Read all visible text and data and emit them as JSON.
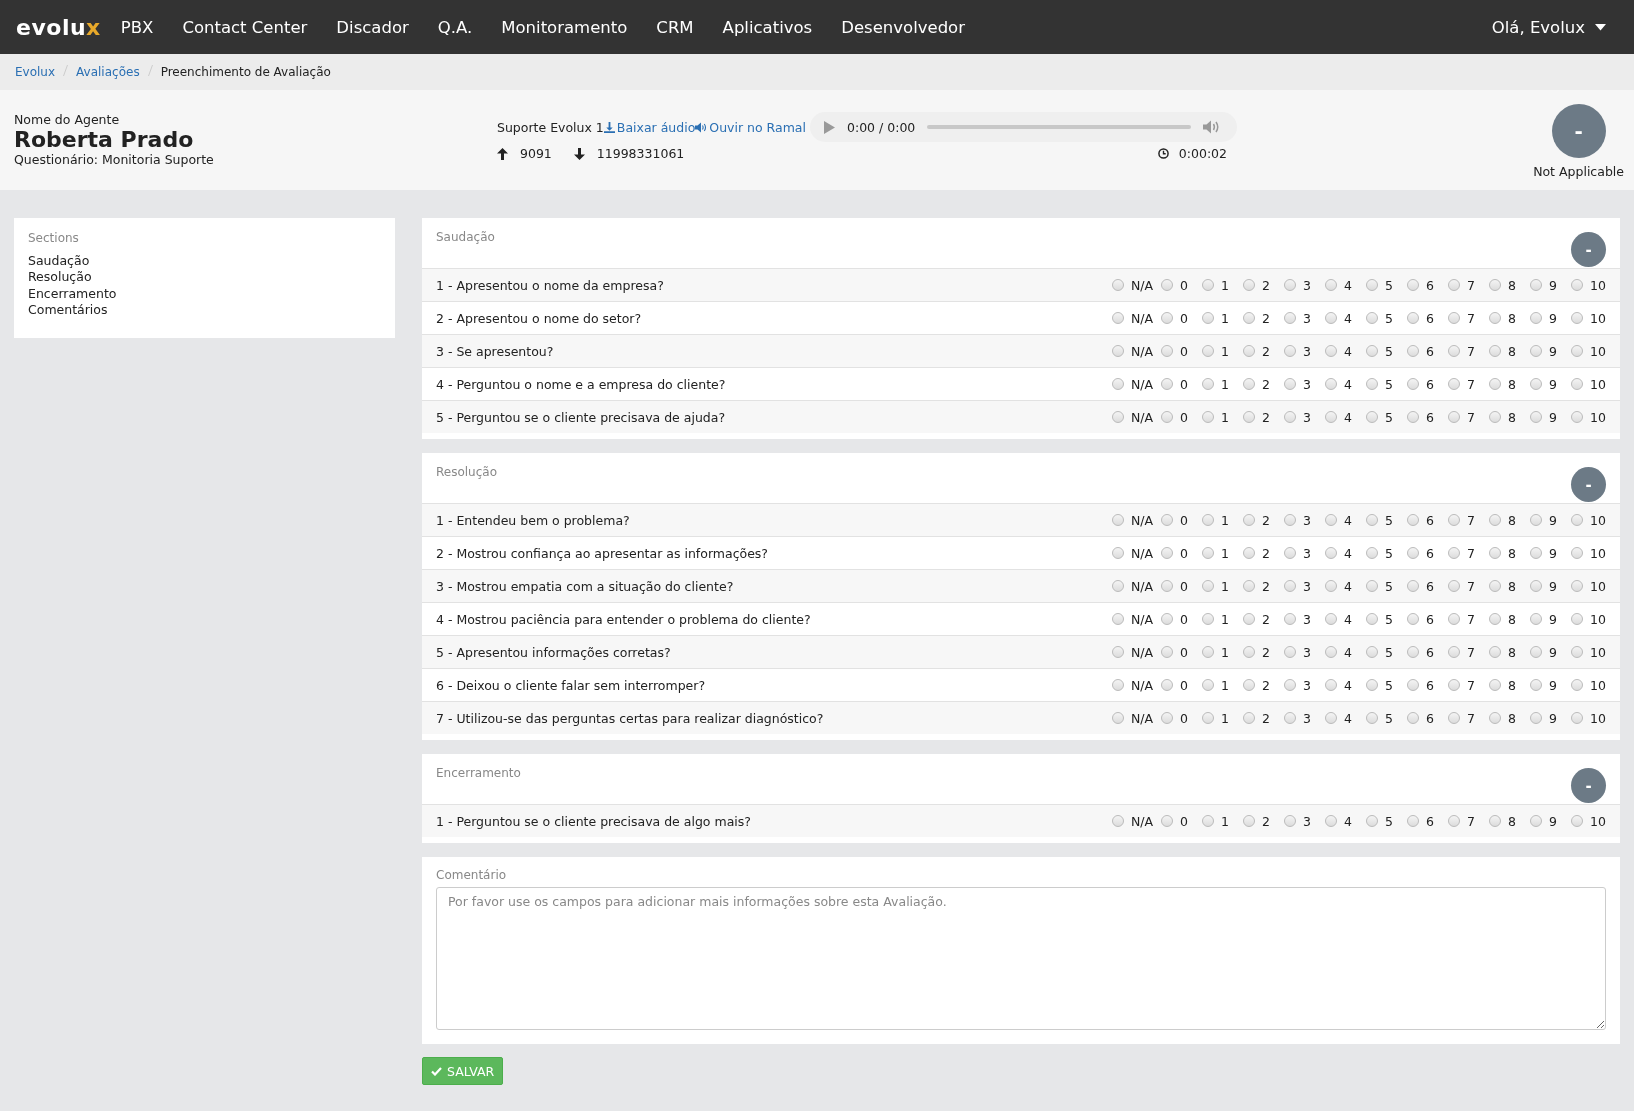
{
  "nav": {
    "logo": {
      "main": "evolu",
      "accent": "x"
    },
    "items": [
      "PBX",
      "Contact Center",
      "Discador",
      "Q.A.",
      "Monitoramento",
      "CRM",
      "Aplicativos",
      "Desenvolvedor"
    ],
    "user": "Olá, Evolux"
  },
  "breadcrumb": [
    {
      "label": "Evolux",
      "link": true
    },
    {
      "label": "Avaliações",
      "link": true
    },
    {
      "label": "Preenchimento de Avaliação",
      "link": false
    }
  ],
  "header": {
    "agent_label": "Nome do Agente",
    "agent_name": "Roberta Prado",
    "questionnaire": "Questionário: Monitoria Suporte",
    "queue": "Suporte Evolux 1",
    "download": "Baixar áudio",
    "listen": "Ouvir no Ramal",
    "player": {
      "time": "0:00 / 0:00"
    },
    "from": "9091",
    "to": "11998331061",
    "duration": "0:00:02",
    "score": "-",
    "score_label": "Not Applicable"
  },
  "sidebar": {
    "title": "Sections",
    "items": [
      "Saudação",
      "Resolução",
      "Encerramento",
      "Comentários"
    ]
  },
  "sections": [
    {
      "title": "Saudação",
      "score": "-",
      "questions": [
        {
          "text": "1 - Apresentou o nome da empresa?",
          "options": [
            {
              "label": "N/A",
              "selected": false
            },
            {
              "label": "0",
              "selected": false
            },
            {
              "label": "1",
              "selected": false
            },
            {
              "label": "2",
              "selected": false
            },
            {
              "label": "3",
              "selected": false
            },
            {
              "label": "4",
              "selected": false
            },
            {
              "label": "5",
              "selected": false
            },
            {
              "label": "6",
              "selected": false
            },
            {
              "label": "7",
              "selected": false
            },
            {
              "label": "8",
              "selected": false
            },
            {
              "label": "9",
              "selected": false
            },
            {
              "label": "10",
              "selected": false
            }
          ]
        },
        {
          "text": "2 - Apresentou o nome do setor?",
          "options": [
            {
              "label": "N/A",
              "selected": false
            },
            {
              "label": "0",
              "selected": false
            },
            {
              "label": "1",
              "selected": false
            },
            {
              "label": "2",
              "selected": false
            },
            {
              "label": "3",
              "selected": false
            },
            {
              "label": "4",
              "selected": false
            },
            {
              "label": "5",
              "selected": false
            },
            {
              "label": "6",
              "selected": false
            },
            {
              "label": "7",
              "selected": false
            },
            {
              "label": "8",
              "selected": false
            },
            {
              "label": "9",
              "selected": false
            },
            {
              "label": "10",
              "selected": false
            }
          ]
        },
        {
          "text": "3 - Se apresentou?",
          "options": [
            {
              "label": "N/A",
              "selected": false
            },
            {
              "label": "0",
              "selected": false
            },
            {
              "label": "1",
              "selected": false
            },
            {
              "label": "2",
              "selected": false
            },
            {
              "label": "3",
              "selected": false
            },
            {
              "label": "4",
              "selected": false
            },
            {
              "label": "5",
              "selected": false
            },
            {
              "label": "6",
              "selected": false
            },
            {
              "label": "7",
              "selected": false
            },
            {
              "label": "8",
              "selected": false
            },
            {
              "label": "9",
              "selected": false
            },
            {
              "label": "10",
              "selected": false
            }
          ]
        },
        {
          "text": "4 - Perguntou o nome e a empresa do cliente?",
          "options": [
            {
              "label": "N/A",
              "selected": false
            },
            {
              "label": "0",
              "selected": false
            },
            {
              "label": "1",
              "selected": false
            },
            {
              "label": "2",
              "selected": false
            },
            {
              "label": "3",
              "selected": false
            },
            {
              "label": "4",
              "selected": false
            },
            {
              "label": "5",
              "selected": false
            },
            {
              "label": "6",
              "selected": false
            },
            {
              "label": "7",
              "selected": false
            },
            {
              "label": "8",
              "selected": false
            },
            {
              "label": "9",
              "selected": false
            },
            {
              "label": "10",
              "selected": false
            }
          ]
        },
        {
          "text": "5 - Perguntou se o cliente precisava de ajuda?",
          "options": [
            {
              "label": "N/A",
              "selected": false
            },
            {
              "label": "0",
              "selected": false
            },
            {
              "label": "1",
              "selected": false
            },
            {
              "label": "2",
              "selected": false
            },
            {
              "label": "3",
              "selected": false
            },
            {
              "label": "4",
              "selected": false
            },
            {
              "label": "5",
              "selected": false
            },
            {
              "label": "6",
              "selected": false
            },
            {
              "label": "7",
              "selected": false
            },
            {
              "label": "8",
              "selected": false
            },
            {
              "label": "9",
              "selected": false
            },
            {
              "label": "10",
              "selected": false
            }
          ]
        }
      ]
    },
    {
      "title": "Resolução",
      "score": "-",
      "questions": [
        {
          "text": "1 - Entendeu bem o problema?",
          "options": [
            {
              "label": "N/A",
              "selected": false
            },
            {
              "label": "0",
              "selected": false
            },
            {
              "label": "1",
              "selected": false
            },
            {
              "label": "2",
              "selected": false
            },
            {
              "label": "3",
              "selected": false
            },
            {
              "label": "4",
              "selected": false
            },
            {
              "label": "5",
              "selected": false
            },
            {
              "label": "6",
              "selected": false
            },
            {
              "label": "7",
              "selected": false
            },
            {
              "label": "8",
              "selected": false
            },
            {
              "label": "9",
              "selected": false
            },
            {
              "label": "10",
              "selected": false
            }
          ]
        },
        {
          "text": "2 - Mostrou confiança ao apresentar as informações?",
          "options": [
            {
              "label": "N/A",
              "selected": false
            },
            {
              "label": "0",
              "selected": false
            },
            {
              "label": "1",
              "selected": false
            },
            {
              "label": "2",
              "selected": false
            },
            {
              "label": "3",
              "selected": false
            },
            {
              "label": "4",
              "selected": false
            },
            {
              "label": "5",
              "selected": false
            },
            {
              "label": "6",
              "selected": false
            },
            {
              "label": "7",
              "selected": false
            },
            {
              "label": "8",
              "selected": false
            },
            {
              "label": "9",
              "selected": false
            },
            {
              "label": "10",
              "selected": false
            }
          ]
        },
        {
          "text": "3 - Mostrou empatia com a situação do cliente?",
          "options": [
            {
              "label": "N/A",
              "selected": false
            },
            {
              "label": "0",
              "selected": false
            },
            {
              "label": "1",
              "selected": false
            },
            {
              "label": "2",
              "selected": false
            },
            {
              "label": "3",
              "selected": false
            },
            {
              "label": "4",
              "selected": false
            },
            {
              "label": "5",
              "selected": false
            },
            {
              "label": "6",
              "selected": false
            },
            {
              "label": "7",
              "selected": false
            },
            {
              "label": "8",
              "selected": false
            },
            {
              "label": "9",
              "selected": false
            },
            {
              "label": "10",
              "selected": false
            }
          ]
        },
        {
          "text": "4 - Mostrou paciência para entender o problema do cliente?",
          "options": [
            {
              "label": "N/A",
              "selected": false
            },
            {
              "label": "0",
              "selected": false
            },
            {
              "label": "1",
              "selected": false
            },
            {
              "label": "2",
              "selected": false
            },
            {
              "label": "3",
              "selected": false
            },
            {
              "label": "4",
              "selected": false
            },
            {
              "label": "5",
              "selected": false
            },
            {
              "label": "6",
              "selected": false
            },
            {
              "label": "7",
              "selected": false
            },
            {
              "label": "8",
              "selected": false
            },
            {
              "label": "9",
              "selected": false
            },
            {
              "label": "10",
              "selected": false
            }
          ]
        },
        {
          "text": "5 - Apresentou informações corretas?",
          "options": [
            {
              "label": "N/A",
              "selected": false
            },
            {
              "label": "0",
              "selected": false
            },
            {
              "label": "1",
              "selected": false
            },
            {
              "label": "2",
              "selected": false
            },
            {
              "label": "3",
              "selected": false
            },
            {
              "label": "4",
              "selected": false
            },
            {
              "label": "5",
              "selected": false
            },
            {
              "label": "6",
              "selected": false
            },
            {
              "label": "7",
              "selected": false
            },
            {
              "label": "8",
              "selected": false
            },
            {
              "label": "9",
              "selected": false
            },
            {
              "label": "10",
              "selected": false
            }
          ]
        },
        {
          "text": "6 - Deixou o cliente falar sem interromper?",
          "options": [
            {
              "label": "N/A",
              "selected": false
            },
            {
              "label": "0",
              "selected": false
            },
            {
              "label": "1",
              "selected": false
            },
            {
              "label": "2",
              "selected": false
            },
            {
              "label": "3",
              "selected": false
            },
            {
              "label": "4",
              "selected": false
            },
            {
              "label": "5",
              "selected": false
            },
            {
              "label": "6",
              "selected": false
            },
            {
              "label": "7",
              "selected": false
            },
            {
              "label": "8",
              "selected": false
            },
            {
              "label": "9",
              "selected": false
            },
            {
              "label": "10",
              "selected": false
            }
          ]
        },
        {
          "text": "7 - Utilizou-se das perguntas certas para realizar diagnóstico?",
          "options": [
            {
              "label": "N/A",
              "selected": false
            },
            {
              "label": "0",
              "selected": false
            },
            {
              "label": "1",
              "selected": false
            },
            {
              "label": "2",
              "selected": false
            },
            {
              "label": "3",
              "selected": false
            },
            {
              "label": "4",
              "selected": false
            },
            {
              "label": "5",
              "selected": false
            },
            {
              "label": "6",
              "selected": false
            },
            {
              "label": "7",
              "selected": false
            },
            {
              "label": "8",
              "selected": false
            },
            {
              "label": "9",
              "selected": false
            },
            {
              "label": "10",
              "selected": false
            }
          ]
        }
      ]
    },
    {
      "title": "Encerramento",
      "score": "-",
      "questions": [
        {
          "text": "1 - Perguntou se o cliente precisava de algo mais?",
          "options": [
            {
              "label": "N/A",
              "selected": false
            },
            {
              "label": "0",
              "selected": false
            },
            {
              "label": "1",
              "selected": false
            },
            {
              "label": "2",
              "selected": false
            },
            {
              "label": "3",
              "selected": false
            },
            {
              "label": "4",
              "selected": false
            },
            {
              "label": "5",
              "selected": false
            },
            {
              "label": "6",
              "selected": false
            },
            {
              "label": "7",
              "selected": false
            },
            {
              "label": "8",
              "selected": false
            },
            {
              "label": "9",
              "selected": false
            },
            {
              "label": "10",
              "selected": false
            }
          ]
        }
      ]
    }
  ],
  "comment": {
    "label": "Comentário",
    "placeholder": "Por favor use os campos para adicionar mais informações sobre esta Avaliação."
  },
  "save_button": "SALVAR"
}
